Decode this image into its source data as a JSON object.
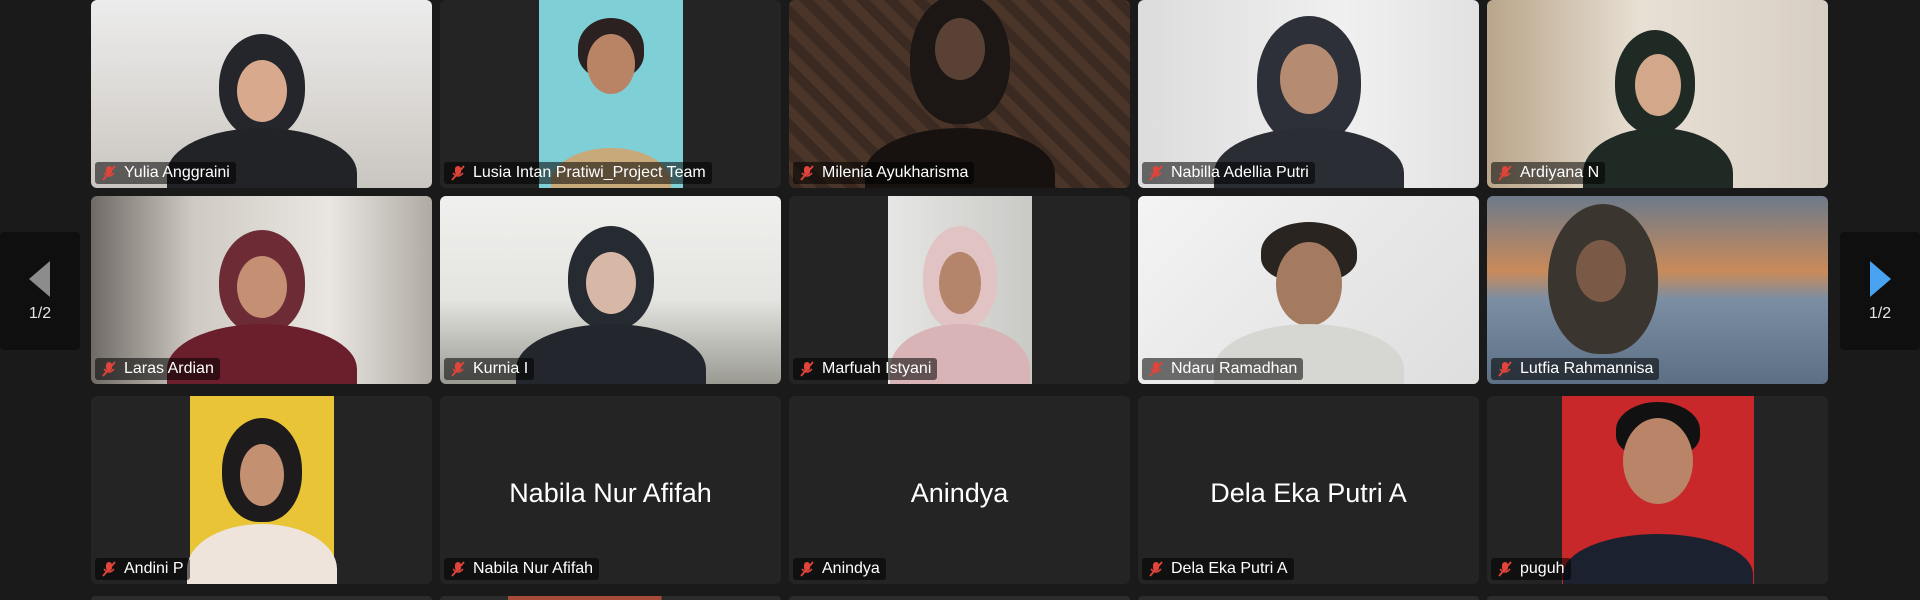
{
  "pagination": {
    "left_label": "1/2",
    "right_label": "1/2",
    "left_icon": "chevron-left-icon",
    "right_icon": "chevron-right-icon",
    "right_arrow_color": "#4aa3f0",
    "left_arrow_color": "#8c8c8c"
  },
  "mic_icon": "mic-muted-icon",
  "mic_color": "#e0443a",
  "participants": [
    {
      "name": "Yulia Anggraini",
      "video": true
    },
    {
      "name": "Lusia Intan Pratiwi_Project Team",
      "video": true
    },
    {
      "name": "Milenia Ayukharisma",
      "video": true
    },
    {
      "name": "Nabilla Adellia Putri",
      "video": true
    },
    {
      "name": "Ardiyana N",
      "video": true
    },
    {
      "name": "Laras Ardian",
      "video": true
    },
    {
      "name": "Kurnia I",
      "video": true
    },
    {
      "name": "Marfuah Istyani",
      "video": true
    },
    {
      "name": "Ndaru Ramadhan",
      "video": true,
      "speaking": true
    },
    {
      "name": "Lutfia Rahmannisa",
      "video": true
    },
    {
      "name": "Andini P",
      "video": true
    },
    {
      "name": "Nabila Nur Afifah",
      "video": false,
      "display_name": "Nabila Nur Afifah"
    },
    {
      "name": "Anindya",
      "video": false,
      "display_name": "Anindya"
    },
    {
      "name": "Dela Eka Putri A",
      "video": false,
      "display_name": "Dela Eka Putri A"
    },
    {
      "name": "puguh",
      "video": true
    }
  ]
}
